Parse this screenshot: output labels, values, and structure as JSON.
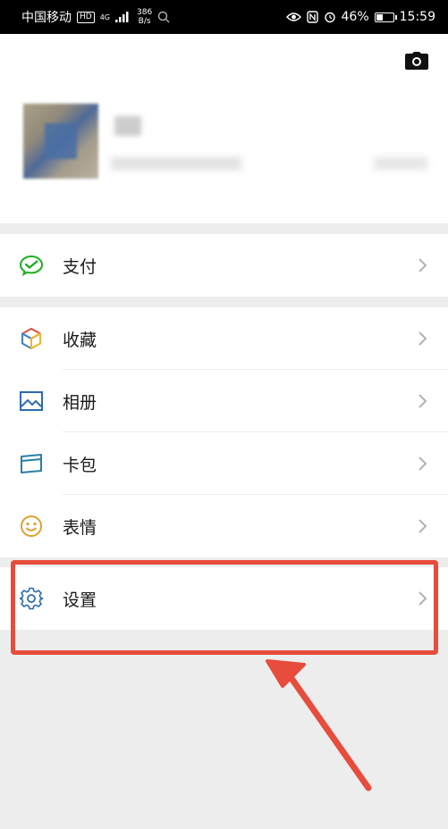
{
  "status_bar": {
    "carrier": "中国移动",
    "hd_label": "HD",
    "network_type": "4G",
    "speed_value": "386",
    "speed_unit": "B/s",
    "battery_percent": "46%",
    "battery_level": 0.46,
    "time": "15:59"
  },
  "profile": {
    "camera_icon": "camera-icon"
  },
  "menu": {
    "pay": {
      "label": "支付",
      "icon": "wechat-pay-icon",
      "color": "#1aad19"
    },
    "favorites": {
      "label": "收藏",
      "icon": "cube-icon"
    },
    "album": {
      "label": "相册",
      "icon": "image-icon",
      "color": "#2b6cb0"
    },
    "cards": {
      "label": "卡包",
      "icon": "card-icon",
      "color": "#2b7fa8"
    },
    "stickers": {
      "label": "表情",
      "icon": "smiley-icon",
      "color": "#e0a030"
    },
    "settings": {
      "label": "设置",
      "icon": "gear-icon",
      "color": "#2b6cb0"
    }
  },
  "annotation": {
    "highlight_color": "#e74c3c"
  }
}
